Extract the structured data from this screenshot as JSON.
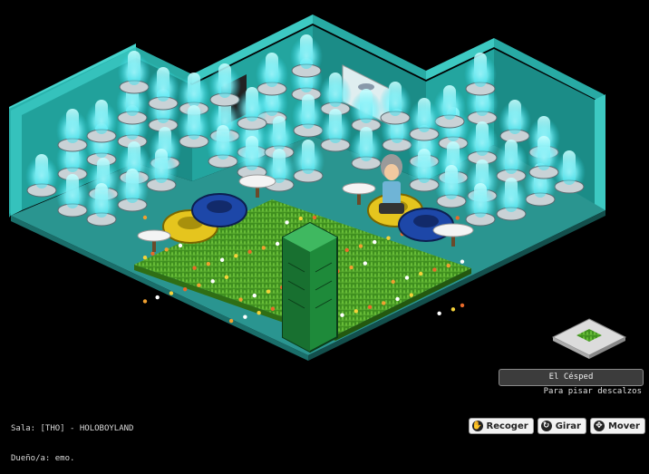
{
  "room": {
    "name_line": "Sala: [THO] - HOLOBOYLAND",
    "owner_line": "Dueño/a: emo."
  },
  "furni_info": {
    "name": "El Césped",
    "description": "Para pisar descalzos"
  },
  "actions": [
    {
      "label": "Recoger",
      "icon": "hand-icon"
    },
    {
      "label": "Girar",
      "icon": "rotate-icon"
    },
    {
      "label": "Mover",
      "icon": "move-icon"
    }
  ],
  "colors": {
    "background": "#000000",
    "wall_light": "#2bb7b2",
    "wall_dark": "#1a8f8a",
    "floor": "#2f9b96",
    "grass": "#3e8a1d",
    "hologram": "#7ef7ff",
    "phone_booth": "#1f8a3a",
    "chair_yellow": "#e0c21c",
    "chair_blue": "#1b3f9a"
  }
}
